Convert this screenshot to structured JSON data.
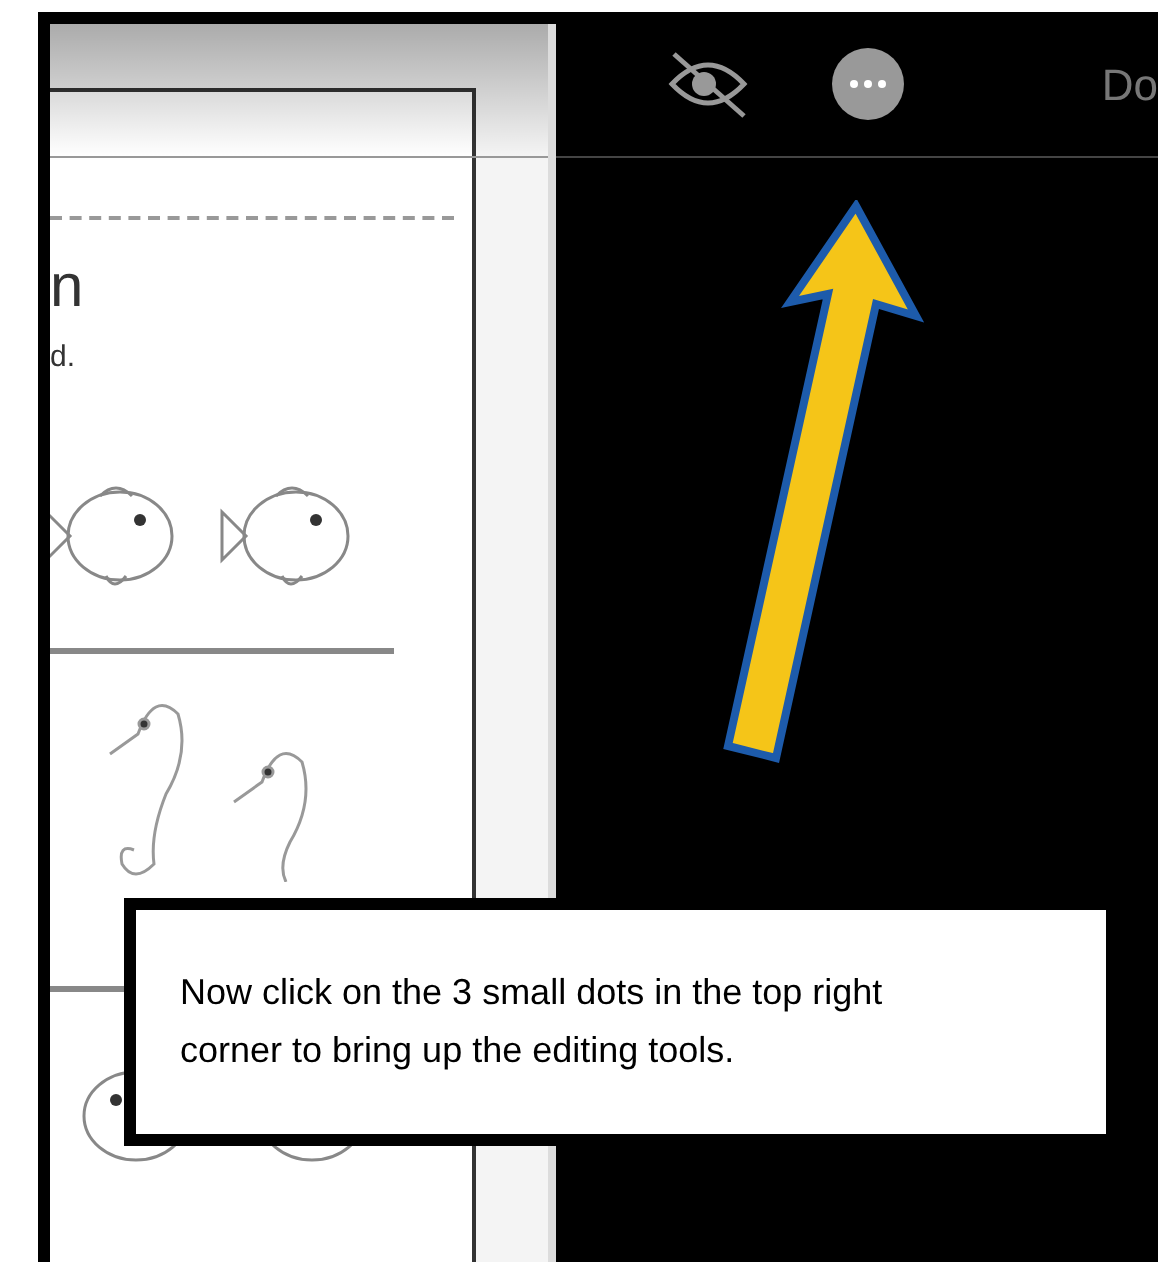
{
  "toolbar": {
    "done_label": "Do"
  },
  "document": {
    "heading_fragment": "n",
    "text_fragment": "d."
  },
  "callout": {
    "text": "Now click on the 3 small dots in the top right corner to bring up the editing tools."
  }
}
